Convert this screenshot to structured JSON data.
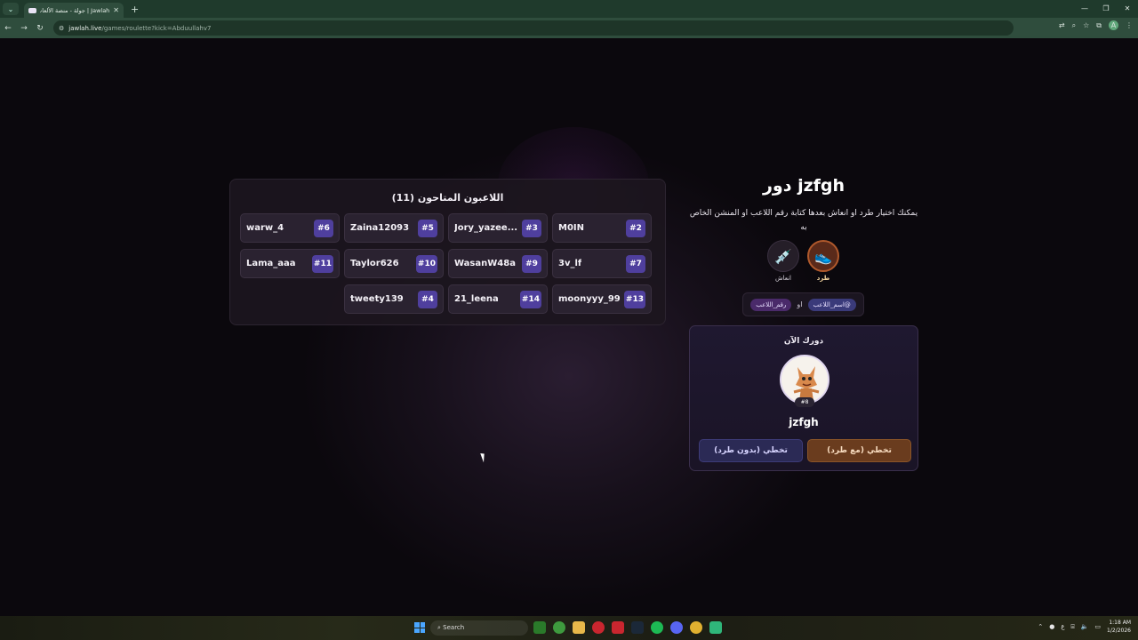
{
  "browser": {
    "tab_title": "Jawlah | جولة - منصة الألعاب ال",
    "url_host": "jawlah.live",
    "url_path": "/games/roulette?kick=Abduullahv7"
  },
  "players_panel": {
    "title": "اللاعبون المتاحون (11)",
    "players": [
      {
        "name": "M0IN",
        "num": "#2"
      },
      {
        "name": "Jory_yazee...",
        "num": "#3"
      },
      {
        "name": "Zaina12093",
        "num": "#5"
      },
      {
        "name": "warw_4",
        "num": "#6"
      },
      {
        "name": "3v_lf",
        "num": "#7"
      },
      {
        "name": "WasanW48a",
        "num": "#9"
      },
      {
        "name": "Taylor626",
        "num": "#10"
      },
      {
        "name": "Lama_aaa",
        "num": "#11"
      },
      {
        "name": "moonyyy_99",
        "num": "#13"
      },
      {
        "name": "21_leena",
        "num": "#14"
      },
      {
        "name": "tweety139",
        "num": "#4"
      }
    ]
  },
  "turn": {
    "title": "دور jzfgh",
    "description": "يمكنك اختيار طرد او انعاش بعدها كتابة رقم اللاعب او المنشن الخاص به",
    "kick_label": "طرد",
    "revive_label": "انعاش",
    "mention_or": "او",
    "pill_name": "@اسم_اللاعب",
    "pill_number": "رقم_اللاعب"
  },
  "current": {
    "label": "دورك الآن",
    "badge": "#8",
    "name": "jzfgh",
    "skip_with_kick": "تخطي (مع طرد)",
    "skip_without_kick": "تخطي (بدون طرد)"
  },
  "taskbar": {
    "search": "Search",
    "time": "1:18 AM",
    "date": "1/2/2026",
    "lang": "ع"
  }
}
